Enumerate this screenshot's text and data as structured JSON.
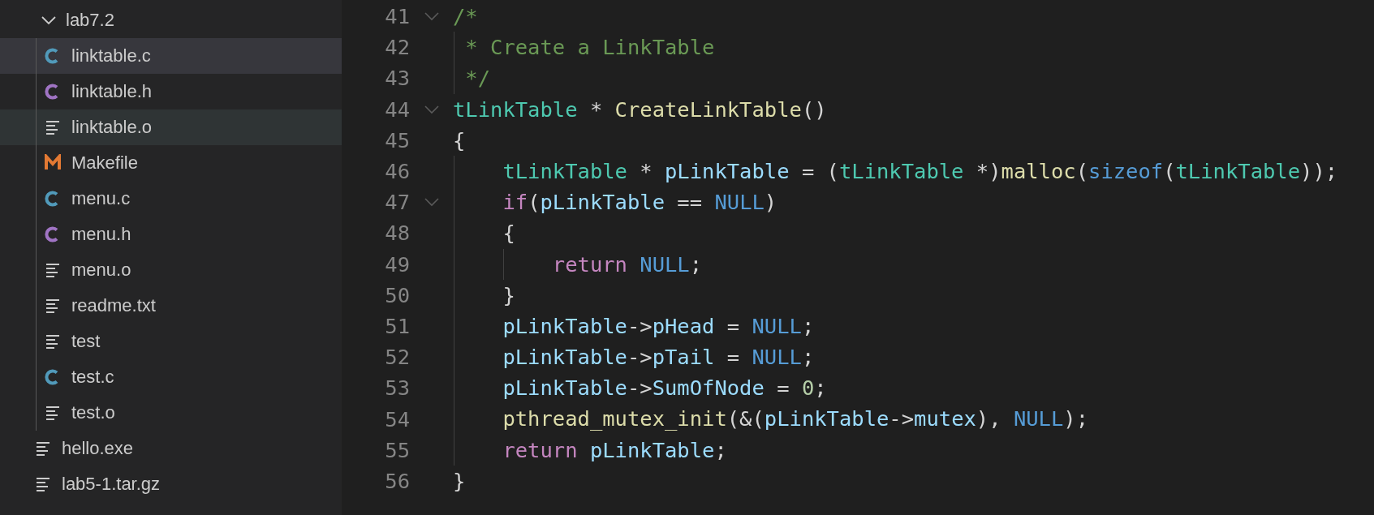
{
  "explorer": {
    "items": [
      {
        "name": "lab7.2",
        "kind": "folder",
        "expanded": true,
        "selected": false,
        "hovered": false,
        "children": [
          {
            "name": "linktable.c",
            "kind": "c",
            "selected": true,
            "hovered": false
          },
          {
            "name": "linktable.h",
            "kind": "h",
            "selected": false,
            "hovered": false
          },
          {
            "name": "linktable.o",
            "kind": "text",
            "selected": false,
            "hovered": true
          },
          {
            "name": "Makefile",
            "kind": "make",
            "selected": false,
            "hovered": false
          },
          {
            "name": "menu.c",
            "kind": "c",
            "selected": false,
            "hovered": false
          },
          {
            "name": "menu.h",
            "kind": "h",
            "selected": false,
            "hovered": false
          },
          {
            "name": "menu.o",
            "kind": "text",
            "selected": false,
            "hovered": false
          },
          {
            "name": "readme.txt",
            "kind": "text",
            "selected": false,
            "hovered": false
          },
          {
            "name": "test",
            "kind": "text",
            "selected": false,
            "hovered": false
          },
          {
            "name": "test.c",
            "kind": "c",
            "selected": false,
            "hovered": false
          },
          {
            "name": "test.o",
            "kind": "text",
            "selected": false,
            "hovered": false
          }
        ]
      },
      {
        "name": "hello.exe",
        "kind": "text",
        "selected": false,
        "hovered": false
      },
      {
        "name": "lab5-1.tar.gz",
        "kind": "text",
        "selected": false,
        "hovered": false
      }
    ]
  },
  "editor": {
    "lines": [
      {
        "number": "41",
        "fold": true,
        "segments": [
          {
            "text": "/*",
            "kind": "comment"
          }
        ]
      },
      {
        "number": "42",
        "fold": false,
        "segments": [
          {
            "text": " * Create a LinkTable",
            "kind": "comment"
          }
        ]
      },
      {
        "number": "43",
        "fold": false,
        "segments": [
          {
            "text": " */",
            "kind": "comment"
          }
        ]
      },
      {
        "number": "44",
        "fold": true,
        "segments": [
          {
            "text": "tLinkTable",
            "kind": "type"
          },
          {
            "text": " * ",
            "kind": "plain"
          },
          {
            "text": "CreateLinkTable",
            "kind": "func"
          },
          {
            "text": "()",
            "kind": "plain"
          }
        ]
      },
      {
        "number": "45",
        "fold": false,
        "segments": [
          {
            "text": "{",
            "kind": "plain"
          }
        ]
      },
      {
        "number": "46",
        "fold": false,
        "segments": [
          {
            "text": "    tLinkTable",
            "kind": "type"
          },
          {
            "text": " * ",
            "kind": "plain"
          },
          {
            "text": "pLinkTable",
            "kind": "var"
          },
          {
            "text": " = (",
            "kind": "plain"
          },
          {
            "text": "tLinkTable",
            "kind": "type"
          },
          {
            "text": " *)",
            "kind": "plain"
          },
          {
            "text": "malloc",
            "kind": "func"
          },
          {
            "text": "(",
            "kind": "plain"
          },
          {
            "text": "sizeof",
            "kind": "keyword"
          },
          {
            "text": "(",
            "kind": "plain"
          },
          {
            "text": "tLinkTable",
            "kind": "type"
          },
          {
            "text": "));",
            "kind": "plain"
          }
        ]
      },
      {
        "number": "47",
        "fold": true,
        "segments": [
          {
            "text": "    if",
            "kind": "control"
          },
          {
            "text": "(",
            "kind": "plain"
          },
          {
            "text": "pLinkTable",
            "kind": "var"
          },
          {
            "text": " == ",
            "kind": "plain"
          },
          {
            "text": "NULL",
            "kind": "keyword"
          },
          {
            "text": ")",
            "kind": "plain"
          }
        ]
      },
      {
        "number": "48",
        "fold": false,
        "segments": [
          {
            "text": "    {",
            "kind": "plain"
          }
        ]
      },
      {
        "number": "49",
        "fold": false,
        "segments": [
          {
            "text": "        return",
            "kind": "control"
          },
          {
            "text": " NULL",
            "kind": "keyword"
          },
          {
            "text": ";",
            "kind": "plain"
          }
        ]
      },
      {
        "number": "50",
        "fold": false,
        "segments": [
          {
            "text": "    }",
            "kind": "plain"
          }
        ]
      },
      {
        "number": "51",
        "fold": false,
        "segments": [
          {
            "text": "    pLinkTable",
            "kind": "var"
          },
          {
            "text": "->",
            "kind": "plain"
          },
          {
            "text": "pHead",
            "kind": "var"
          },
          {
            "text": " = ",
            "kind": "plain"
          },
          {
            "text": "NULL",
            "kind": "keyword"
          },
          {
            "text": ";",
            "kind": "plain"
          }
        ]
      },
      {
        "number": "52",
        "fold": false,
        "segments": [
          {
            "text": "    pLinkTable",
            "kind": "var"
          },
          {
            "text": "->",
            "kind": "plain"
          },
          {
            "text": "pTail",
            "kind": "var"
          },
          {
            "text": " = ",
            "kind": "plain"
          },
          {
            "text": "NULL",
            "kind": "keyword"
          },
          {
            "text": ";",
            "kind": "plain"
          }
        ]
      },
      {
        "number": "53",
        "fold": false,
        "segments": [
          {
            "text": "    pLinkTable",
            "kind": "var"
          },
          {
            "text": "->",
            "kind": "plain"
          },
          {
            "text": "SumOfNode",
            "kind": "var"
          },
          {
            "text": " = ",
            "kind": "plain"
          },
          {
            "text": "0",
            "kind": "number"
          },
          {
            "text": ";",
            "kind": "plain"
          }
        ]
      },
      {
        "number": "54",
        "fold": false,
        "segments": [
          {
            "text": "    pthread_mutex_init",
            "kind": "func"
          },
          {
            "text": "(&(",
            "kind": "plain"
          },
          {
            "text": "pLinkTable",
            "kind": "var"
          },
          {
            "text": "->",
            "kind": "plain"
          },
          {
            "text": "mutex",
            "kind": "var"
          },
          {
            "text": "), ",
            "kind": "plain"
          },
          {
            "text": "NULL",
            "kind": "keyword"
          },
          {
            "text": ");",
            "kind": "plain"
          }
        ]
      },
      {
        "number": "55",
        "fold": false,
        "segments": [
          {
            "text": "    return",
            "kind": "control"
          },
          {
            "text": " pLinkTable",
            "kind": "var"
          },
          {
            "text": ";",
            "kind": "plain"
          }
        ]
      },
      {
        "number": "56",
        "fold": false,
        "segments": [
          {
            "text": "}",
            "kind": "plain"
          }
        ]
      }
    ]
  }
}
